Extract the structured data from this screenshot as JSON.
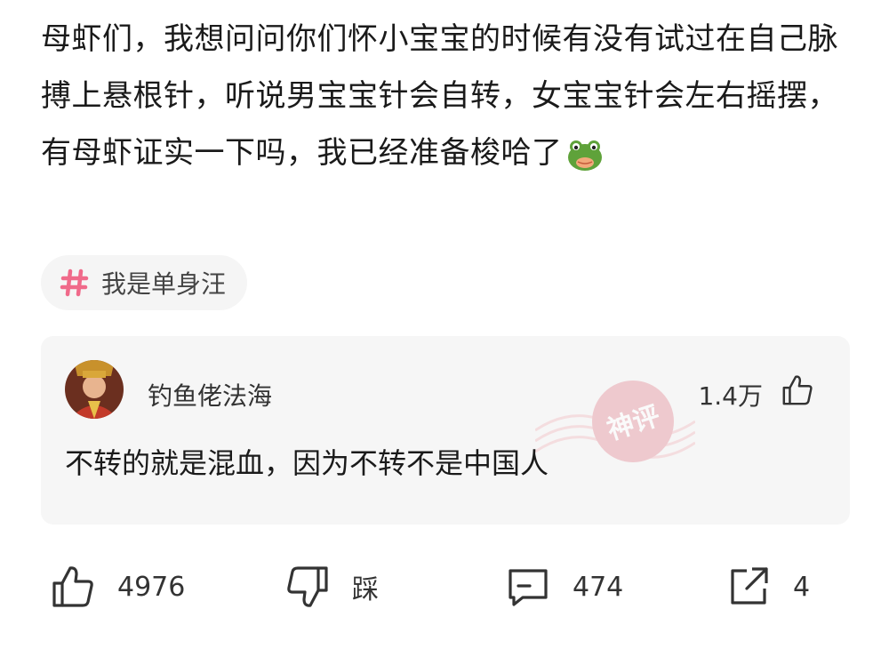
{
  "post": {
    "text": "母虾们，我想问问你们怀小宝宝的时候有没有试过在自己脉搏上悬根针，听说男宝宝针会自转，女宝宝针会左右摇摆，有母虾证实一下吗，我已经准备梭哈了",
    "emoji": "frog-face-emoji"
  },
  "topic": {
    "label": "我是单身汪"
  },
  "hot_comment": {
    "username": "钓鱼佬法海",
    "likes": "1.4万",
    "text": "不转的就是混血，因为不转不是中国人",
    "stamp_label": "神评"
  },
  "actions": {
    "like_count": "4976",
    "dislike_label": "踩",
    "comment_count": "474",
    "share_count": "4"
  },
  "colors": {
    "accent_pink": "#f06a8a",
    "card_bg": "#f6f6f6",
    "stamp_red": "#e9a6ae"
  }
}
